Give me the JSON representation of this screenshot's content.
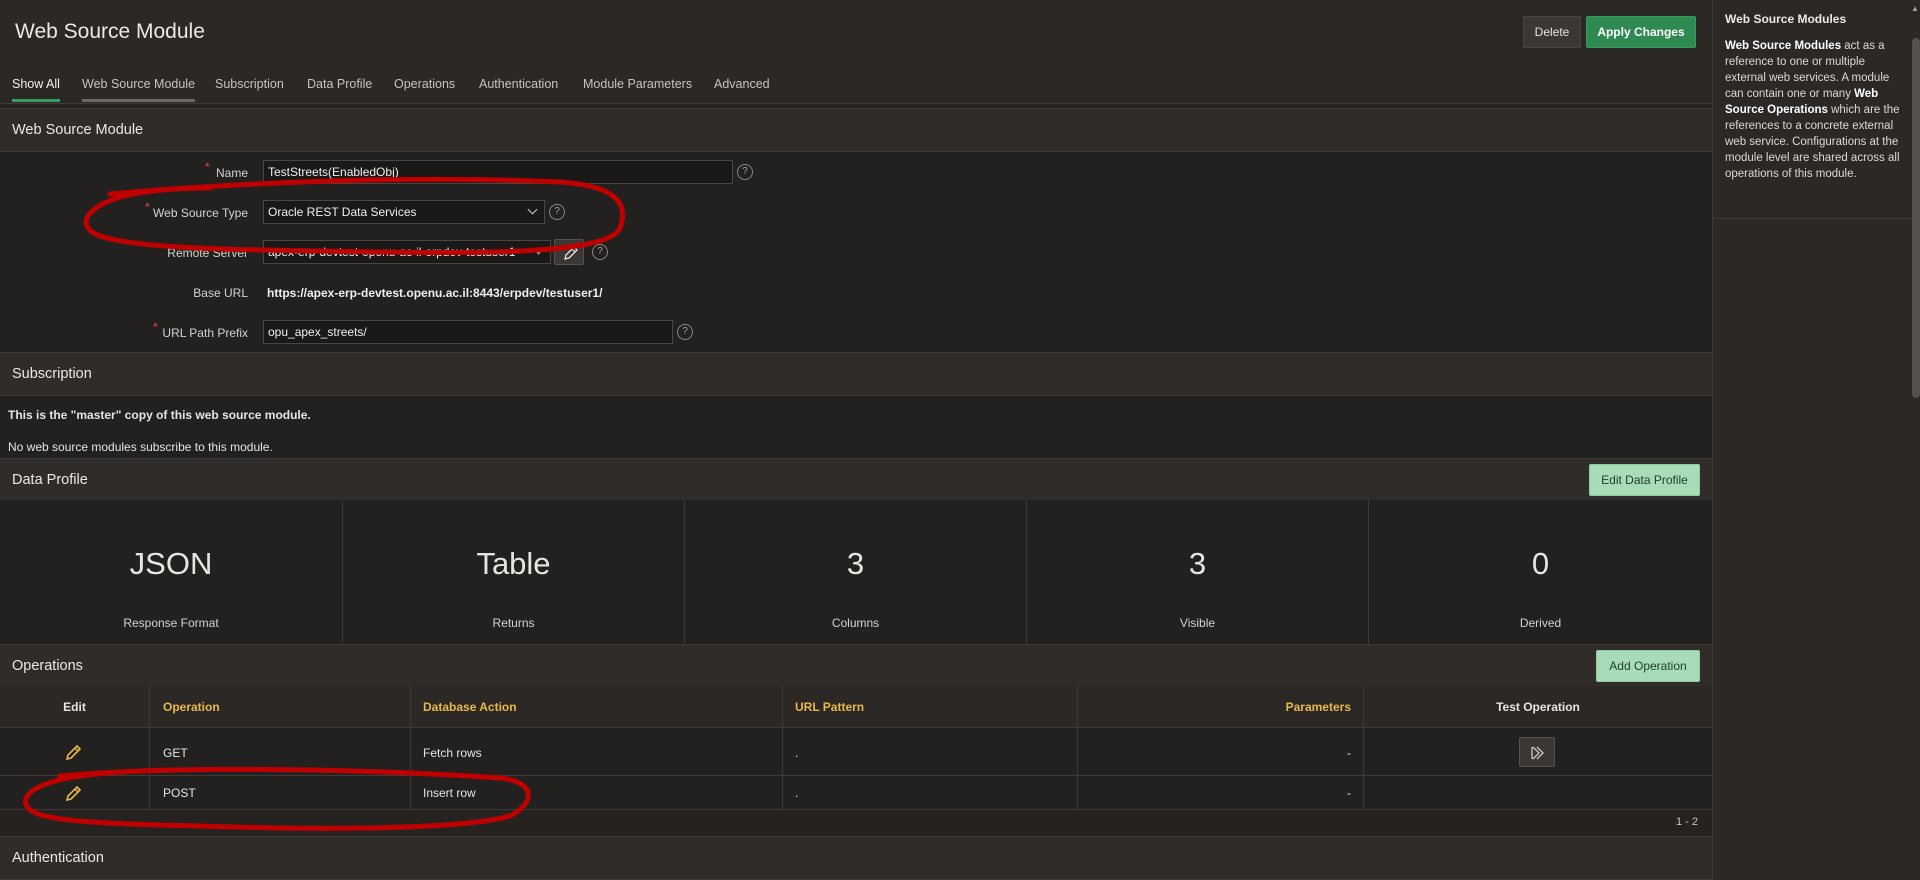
{
  "header": {
    "title": "Web Source Module",
    "delete_label": "Delete",
    "apply_label": "Apply Changes"
  },
  "tabs": [
    {
      "label": "Show All"
    },
    {
      "label": "Web Source Module"
    },
    {
      "label": "Subscription"
    },
    {
      "label": "Data Profile"
    },
    {
      "label": "Operations"
    },
    {
      "label": "Authentication"
    },
    {
      "label": "Module Parameters"
    },
    {
      "label": "Advanced"
    }
  ],
  "module": {
    "section_title": "Web Source Module",
    "name_label": "Name",
    "name_value": "TestStreets(EnabledObj)",
    "type_label": "Web Source Type",
    "type_value": "Oracle REST Data Services",
    "server_label": "Remote Server",
    "server_value": "apex-erp-devtest-openu-ac-il-erpdev-testuser1",
    "base_url_label": "Base URL",
    "base_url_value": "https://apex-erp-devtest.openu.ac.il:8443/erpdev/testuser1/",
    "path_label": "URL Path Prefix",
    "path_value": "opu_apex_streets/",
    "help_glyph": "?"
  },
  "subscription": {
    "section_title": "Subscription",
    "master_text": "This is the \"master\" copy of this web source module.",
    "none_text": "No web source modules subscribe to this module."
  },
  "data_profile": {
    "section_title": "Data Profile",
    "edit_label": "Edit Data Profile",
    "metrics": [
      {
        "value": "JSON",
        "label": "Response Format"
      },
      {
        "value": "Table",
        "label": "Returns"
      },
      {
        "value": "3",
        "label": "Columns"
      },
      {
        "value": "3",
        "label": "Visible"
      },
      {
        "value": "0",
        "label": "Derived"
      }
    ]
  },
  "operations": {
    "section_title": "Operations",
    "add_label": "Add Operation",
    "columns": [
      "Edit",
      "Operation",
      "Database Action",
      "URL Pattern",
      "Parameters",
      "Test Operation"
    ],
    "rows": [
      {
        "operation": "GET",
        "action": "Fetch rows",
        "url": ".",
        "params": "-"
      },
      {
        "operation": "POST",
        "action": "Insert row",
        "url": ".",
        "params": "-"
      }
    ],
    "pagination": "1 - 2"
  },
  "authentication": {
    "section_title": "Authentication"
  },
  "help": {
    "title": "Web Source Modules",
    "bold1": "Web Source Modules",
    "text1": " act as a reference to one or multiple external web services. A module can contain one or many ",
    "bold2": "Web Source Operations",
    "text2": " which are the references to a concrete external web service. Configurations at the module level are shared across all operations of this module."
  },
  "colors": {
    "accent_green": "#2f8a52",
    "header_gold": "#e8b84a",
    "annotation_red": "#c00000",
    "background": "#252220"
  }
}
